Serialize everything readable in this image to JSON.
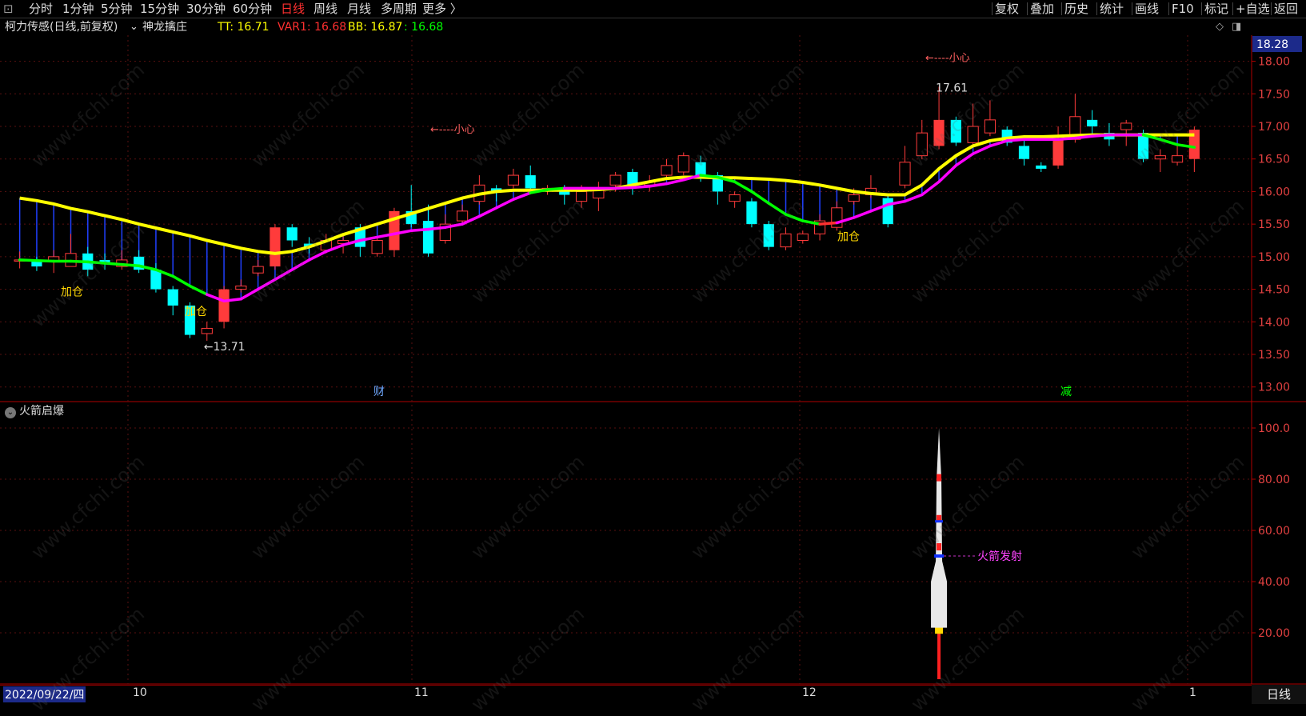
{
  "toolbar": {
    "left": [
      "分时",
      "1分钟",
      "5分钟",
      "15分钟",
      "30分钟",
      "60分钟",
      "日线",
      "周线",
      "月线",
      "多周期",
      "更多 〉"
    ],
    "active": "日线",
    "right": [
      "复权",
      "叠加",
      "历史",
      "统计",
      "画线",
      "F10",
      "标记",
      "+自选",
      "返回"
    ]
  },
  "info": {
    "stock": "柯力传感(日线,前复权)",
    "indicator": "神龙擒庄",
    "tt": "TT: 16.71",
    "var1": "VAR1: 16.68",
    "bb": "BB: 16.87",
    "bb2": ": 16.68",
    "price_badge": "18.28"
  },
  "colors": {
    "up": "#ff3b3b",
    "down": "#00ffff",
    "ma_yellow": "#ffff00",
    "ma_green": "#00ff00",
    "ma_magenta": "#ff00ff",
    "axis_red": "#b00000"
  },
  "main_axis": {
    "ticks": [
      "18.00",
      "17.50",
      "17.00",
      "16.50",
      "16.00",
      "15.50",
      "15.00",
      "14.50",
      "14.00",
      "13.50",
      "13.00"
    ],
    "min": 12.8,
    "max": 18.4
  },
  "annotations": {
    "low": "←13.71",
    "high": "17.61",
    "careful1": "←----小心",
    "careful2": "←----小心",
    "add": "加仓",
    "cai": "财",
    "jian": "减"
  },
  "sub": {
    "title": "火箭启爆",
    "ticks": [
      "100.0",
      "80.00",
      "60.00",
      "40.00",
      "20.00"
    ],
    "launch_label": "火箭发射"
  },
  "dates": {
    "start": "2022/09/22/四",
    "m10": "10",
    "m11": "11",
    "m12": "12",
    "m1": "1",
    "period": "日线"
  },
  "watermark": "www.cfchi.com",
  "chart_data": {
    "type": "candlestick",
    "candles": [
      [
        14.95,
        14.95,
        15.08,
        14.82
      ],
      [
        14.95,
        14.85,
        15.0,
        14.78
      ],
      [
        14.92,
        15.0,
        15.1,
        14.75
      ],
      [
        14.85,
        15.05,
        15.35,
        14.85
      ],
      [
        15.05,
        14.8,
        15.15,
        14.7
      ],
      [
        14.95,
        14.9,
        15.05,
        14.8
      ],
      [
        14.85,
        14.95,
        15.1,
        14.8
      ],
      [
        15.0,
        14.8,
        15.1,
        14.75
      ],
      [
        14.8,
        14.5,
        14.9,
        14.45
      ],
      [
        14.5,
        14.25,
        14.55,
        14.1
      ],
      [
        14.25,
        13.8,
        14.3,
        13.75
      ],
      [
        13.82,
        13.9,
        14.0,
        13.71
      ],
      [
        14.0,
        14.5,
        14.55,
        13.9
      ],
      [
        14.5,
        14.55,
        14.65,
        14.45
      ],
      [
        14.75,
        14.85,
        14.95,
        14.7
      ],
      [
        14.85,
        15.45,
        15.5,
        14.8
      ],
      [
        15.45,
        15.25,
        15.5,
        15.15
      ],
      [
        15.2,
        15.15,
        15.3,
        15.05
      ],
      [
        15.1,
        15.25,
        15.35,
        15.05
      ],
      [
        15.2,
        15.25,
        15.35,
        15.05
      ],
      [
        15.45,
        15.15,
        15.5,
        15.0
      ],
      [
        15.05,
        15.25,
        15.3,
        15.0
      ],
      [
        15.1,
        15.7,
        15.75,
        15.0
      ],
      [
        15.7,
        15.5,
        16.1,
        15.45
      ],
      [
        15.55,
        15.05,
        15.8,
        15.0
      ],
      [
        15.25,
        15.5,
        15.65,
        15.2
      ],
      [
        15.55,
        15.7,
        15.8,
        15.5
      ],
      [
        15.85,
        16.1,
        16.25,
        15.8
      ],
      [
        16.05,
        16.0,
        16.1,
        15.85
      ],
      [
        16.1,
        16.25,
        16.35,
        16.05
      ],
      [
        16.25,
        16.05,
        16.4,
        16.0
      ],
      [
        16.05,
        16.05,
        16.1,
        15.95
      ],
      [
        16.05,
        15.95,
        16.1,
        15.8
      ],
      [
        15.85,
        16.0,
        16.1,
        15.75
      ],
      [
        15.9,
        16.05,
        16.15,
        15.7
      ],
      [
        16.1,
        16.25,
        16.3,
        16.0
      ],
      [
        16.3,
        16.1,
        16.35,
        15.95
      ],
      [
        16.1,
        16.15,
        16.25,
        16.0
      ],
      [
        16.25,
        16.4,
        16.5,
        16.2
      ],
      [
        16.3,
        16.55,
        16.6,
        16.25
      ],
      [
        16.45,
        16.25,
        16.55,
        16.15
      ],
      [
        16.25,
        16.0,
        16.3,
        15.8
      ],
      [
        15.85,
        15.95,
        16.0,
        15.75
      ],
      [
        15.85,
        15.5,
        15.9,
        15.45
      ],
      [
        15.5,
        15.15,
        15.55,
        15.1
      ],
      [
        15.15,
        15.35,
        15.45,
        15.1
      ],
      [
        15.25,
        15.35,
        15.4,
        15.2
      ],
      [
        15.35,
        15.55,
        15.65,
        15.25
      ],
      [
        15.45,
        15.75,
        15.85,
        15.4
      ],
      [
        15.85,
        15.95,
        16.05,
        15.8
      ],
      [
        15.95,
        16.05,
        16.25,
        15.9
      ],
      [
        15.9,
        15.5,
        15.95,
        15.45
      ],
      [
        16.1,
        16.45,
        16.7,
        16.05
      ],
      [
        16.55,
        16.9,
        17.1,
        16.5
      ],
      [
        16.7,
        17.1,
        17.61,
        16.65
      ],
      [
        17.1,
        16.75,
        17.15,
        16.7
      ],
      [
        16.75,
        17.0,
        17.35,
        16.7
      ],
      [
        16.9,
        17.1,
        17.4,
        16.85
      ],
      [
        16.95,
        16.75,
        17.0,
        16.7
      ],
      [
        16.7,
        16.5,
        16.85,
        16.4
      ],
      [
        16.4,
        16.35,
        16.45,
        16.3
      ],
      [
        16.4,
        16.8,
        17.0,
        16.35
      ],
      [
        16.8,
        17.15,
        17.5,
        16.75
      ],
      [
        17.1,
        17.0,
        17.25,
        16.85
      ],
      [
        16.9,
        16.8,
        17.05,
        16.7
      ],
      [
        16.95,
        17.05,
        17.1,
        16.7
      ],
      [
        16.9,
        16.5,
        16.95,
        16.45
      ],
      [
        16.5,
        16.55,
        16.65,
        16.3
      ],
      [
        16.45,
        16.55,
        16.7,
        16.4
      ],
      [
        16.5,
        16.95,
        17.0,
        16.3
      ]
    ],
    "ma_long_yellow": [
      15.9,
      15.86,
      15.81,
      15.74,
      15.69,
      15.63,
      15.57,
      15.5,
      15.44,
      15.38,
      15.32,
      15.25,
      15.19,
      15.13,
      15.08,
      15.05,
      15.08,
      15.15,
      15.24,
      15.34,
      15.42,
      15.5,
      15.58,
      15.66,
      15.74,
      15.82,
      15.9,
      15.96,
      16.0,
      16.02,
      16.02,
      16.02,
      16.02,
      16.02,
      16.03,
      16.05,
      16.1,
      16.15,
      16.2,
      16.22,
      16.22,
      16.21,
      16.21,
      16.2,
      16.19,
      16.17,
      16.14,
      16.1,
      16.05,
      16.0,
      15.97,
      15.95,
      15.95,
      16.1,
      16.35,
      16.55,
      16.7,
      16.78,
      16.82,
      16.84,
      16.84,
      16.85,
      16.86,
      16.87,
      16.87,
      16.87,
      16.87,
      16.87,
      16.87,
      16.87
    ],
    "ma_short": [
      14.95,
      14.94,
      14.93,
      14.93,
      14.92,
      14.9,
      14.88,
      14.86,
      14.8,
      14.7,
      14.55,
      14.42,
      14.32,
      14.35,
      14.5,
      14.65,
      14.8,
      14.95,
      15.08,
      15.18,
      15.25,
      15.3,
      15.35,
      15.4,
      15.42,
      15.45,
      15.5,
      15.62,
      15.75,
      15.88,
      15.98,
      16.03,
      16.05,
      16.05,
      16.05,
      16.05,
      16.06,
      16.08,
      16.12,
      16.18,
      16.25,
      16.22,
      16.15,
      16.0,
      15.82,
      15.65,
      15.55,
      15.5,
      15.52,
      15.6,
      15.7,
      15.8,
      15.85,
      15.95,
      16.15,
      16.4,
      16.58,
      16.7,
      16.78,
      16.8,
      16.8,
      16.8,
      16.82,
      16.85,
      16.87,
      16.87,
      16.87,
      16.8,
      16.72,
      16.68
    ],
    "ma_short_colors": [
      "green",
      "green",
      "green",
      "green",
      "green",
      "green",
      "green",
      "green",
      "green",
      "green",
      "green",
      "green",
      "magenta",
      "magenta",
      "magenta",
      "magenta",
      "magenta",
      "magenta",
      "magenta",
      "magenta",
      "magenta",
      "magenta",
      "magenta",
      "magenta",
      "magenta",
      "magenta",
      "magenta",
      "magenta",
      "magenta",
      "magenta",
      "magenta",
      "green",
      "green",
      "magenta",
      "magenta",
      "magenta",
      "magenta",
      "magenta",
      "magenta",
      "magenta",
      "magenta",
      "green",
      "green",
      "green",
      "green",
      "green",
      "green",
      "green",
      "red",
      "magenta",
      "magenta",
      "magenta",
      "magenta",
      "magenta",
      "magenta",
      "magenta",
      "magenta",
      "magenta",
      "magenta",
      "magenta",
      "magenta",
      "magenta",
      "magenta",
      "magenta",
      "magenta",
      "magenta",
      "magenta",
      "green",
      "green",
      "green"
    ],
    "rocket": {
      "index": 54,
      "value_top": 100,
      "launch_level": 50
    }
  }
}
